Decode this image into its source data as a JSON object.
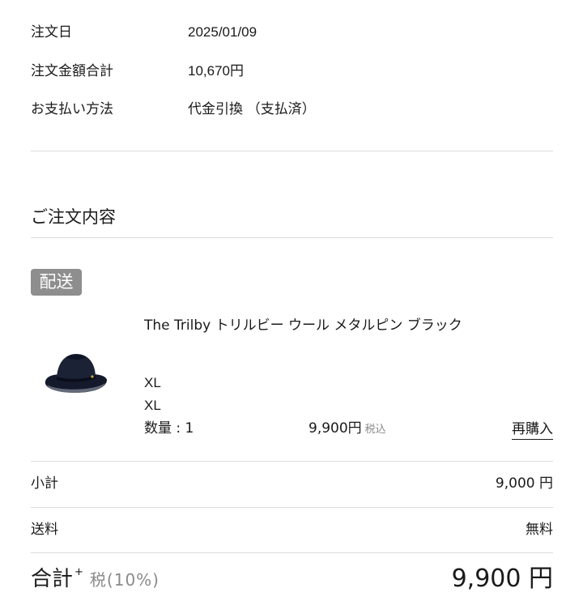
{
  "order_info": {
    "date_label": "注文日",
    "date_value": "2025/01/09",
    "total_label": "注文金額合計",
    "total_value": "10,670円",
    "payment_label": "お支払い方法",
    "payment_value": "代金引換 （支払済）"
  },
  "order_contents": {
    "title": "ご注文内容",
    "shipping_badge": "配送"
  },
  "product": {
    "name": "The Trilby トリルビー ウール メタルピン ブラック",
    "variant_1": "XL",
    "variant_2": "XL",
    "quantity": "数量 : 1",
    "price": "9,900円",
    "tax_note": "税込",
    "rebuy_label": "再購入",
    "image_icon": "trilby-hat-image"
  },
  "summary": {
    "subtotal_label": "小計",
    "subtotal_value": "9,000 円",
    "shipping_label": "送料",
    "shipping_value": "無料",
    "total_label": "合計",
    "total_plus": "+",
    "tax_rate": "税(10%)",
    "total_value": "9,900 円"
  },
  "colors": {
    "badge_bg": "#8e8e8e",
    "divider": "#dcdcdc",
    "muted_text": "#8a8a8a",
    "text": "#1a1a1a"
  }
}
